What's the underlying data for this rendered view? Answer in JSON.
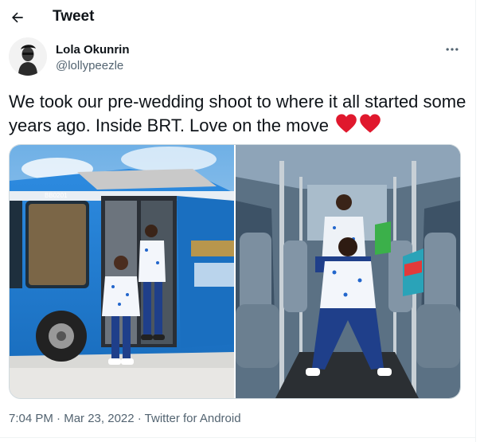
{
  "header": {
    "title": "Tweet"
  },
  "author": {
    "name": "Lola Okunrin",
    "handle": "@lollypeezle"
  },
  "tweet": {
    "text": "We took our pre-wedding shoot to where it all started some years ago. Inside BRT. Love on the move",
    "emoji": [
      "red-heart",
      "red-heart"
    ]
  },
  "media": {
    "bus_number": "BB0201"
  },
  "meta": {
    "time": "7:04 PM",
    "separator1": " · ",
    "date": "Mar 23, 2022",
    "separator2": " · ",
    "source": "Twitter for Android"
  },
  "icons": {
    "back": "arrow-left-icon",
    "more": "more-horizontal-icon"
  },
  "colors": {
    "text": "#0f1419",
    "secondary": "#536471",
    "border": "#cfd9de",
    "heart": "#e0182d",
    "bus_blue": "#1f7fd3"
  }
}
